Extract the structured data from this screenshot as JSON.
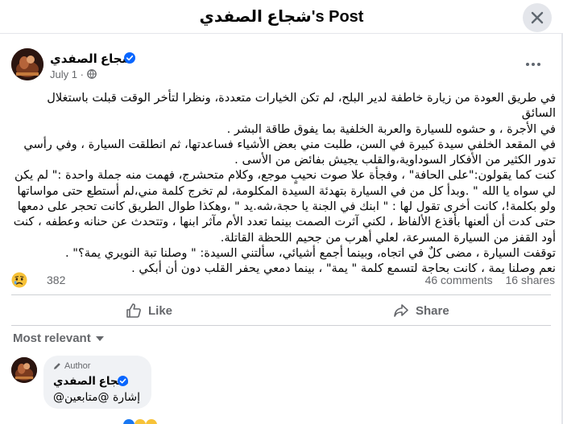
{
  "header": {
    "title": "شجاع الصفدي's Post",
    "close_icon": "close-icon"
  },
  "post": {
    "author_name": "شجاع الصفدي",
    "date": "July 1",
    "separator": "·",
    "privacy_icon": "globe-icon",
    "text_lines": [
      "في طريق العودة من زيارة خاطفة لدير البلح، لم تكن الخيارات متعددة، ونظرا لتأخر الوقت قبلت باستغلال السائق",
      "في الأجرة ، و حشوه للسيارة والعربة الخلفية بما يفوق طاقة البشر .",
      "في المقعد الخلفي سيدة كبيرة في السن، طلبت مني بعض الأشياء فساعدتها، ثم انطلقت السيارة ، وفي رأسي",
      "تدور الكثير من الأفكار السوداوية،والقلب يجيش بفائض من الأسى .",
      "كنت كما يقولون:\"على الحافة\" ،  وفجأة علا صوت نحيبٍ موجع، وكلام متحشرج، فهمت منه جملة واحدة :\"  لم يكن",
      "لي سواه يا الله \" .وبدأ كل من في السيارة بتهدئة السيدة المكلومة، لم تخرج كلمة مني،لم أستطع حتى مواساتها",
      "ولو بكلمة!، كانت أخرى تقول لها : \" ابنك في الجنة يا حجة،شه.يد \" ،وهكذا طوال الطريق كانت تحجر على دمعها",
      "حتى كدت أن ألعنها بأقذع الألفاظ ، لكني آثرت الصمت بينما تعدد الأم مآثر ابنها ، وتتحدث عن حنانه وعطفه ، كنت",
      "أود القفز من السيارة المسرعة، لعلي أهرب من جحيم اللحظة القاتلة.",
      "توقفت السيارة ، مضى كلٌ في اتجاه، وبينما أجمع أشيائي، سألتني السيدة: \" وصلنا تبة النويري يمة؟\" .",
      "نعم وصلنا يمة ، كانت بحاجة لتسمع كلمة \" يمة\" ، بينما دمعي يحفر القلب دون أن أبكي ."
    ],
    "reaction_icon": "sad-face-icon",
    "reaction_count": "382",
    "comments_count": "46 comments",
    "shares_count": "16 shares",
    "like_label": "Like",
    "share_label": "Share"
  },
  "comments": {
    "sort_label": "Most relevant",
    "items": [
      {
        "badge": "Author",
        "name": "شجاع الصفدي",
        "text": "@إشارة @متابعين"
      }
    ]
  },
  "colors": {
    "verified": "#0866ff",
    "secondary_text": "#65676b",
    "divider": "#ced0d4"
  }
}
